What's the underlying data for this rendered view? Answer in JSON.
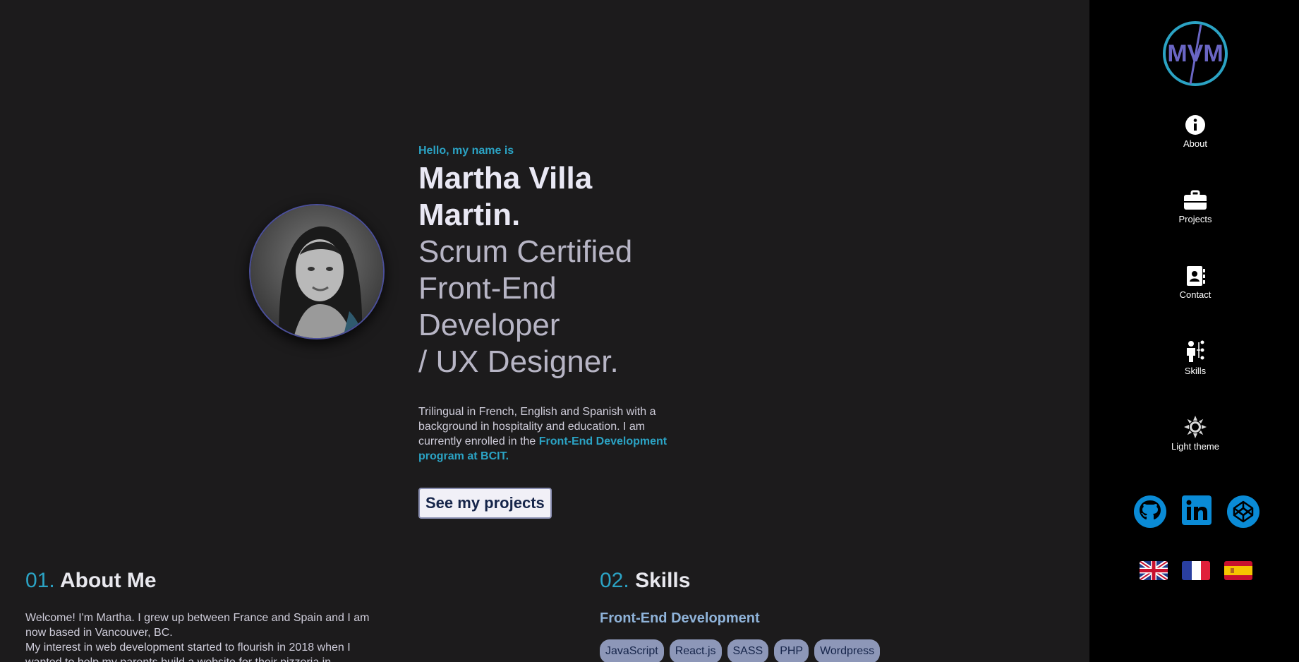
{
  "hero": {
    "greeting": "Hello, my name is",
    "name": "Martha Villa Martin.",
    "role_line1": "Scrum Certified",
    "role_line2": "Front-End Developer",
    "role_line3": "/ UX Designer.",
    "intro": "Trilingual in French, English and Spanish with a background in hospitality and education. I am currently enrolled in the ",
    "intro_highlight": "Front-End Development program at BCIT.",
    "cta_label": "See my projects"
  },
  "about": {
    "number": "01.",
    "title": "About Me",
    "paragraph1": "Welcome! I'm Martha. I grew up between France and Spain and I am now based in Vancouver, BC.",
    "paragraph2": "My interest in web development started to flourish in 2018 when I wanted to help my parents build a website for their pizzeria in"
  },
  "skills": {
    "number": "02.",
    "title": "Skills",
    "subtitle": "Front-End Development",
    "tags": [
      "JavaScript",
      "React.js",
      "SASS",
      "PHP",
      "Wordpress"
    ]
  },
  "sidebar": {
    "logo_text": "MVM",
    "nav": [
      {
        "label": "About",
        "icon": "info-icon"
      },
      {
        "label": "Projects",
        "icon": "briefcase-icon"
      },
      {
        "label": "Contact",
        "icon": "contact-book-icon"
      },
      {
        "label": "Skills",
        "icon": "skills-icon"
      },
      {
        "label": "Light theme",
        "icon": "sun-icon"
      }
    ],
    "social": [
      "github-icon",
      "linkedin-icon",
      "codepen-icon"
    ],
    "languages": [
      "uk-flag-icon",
      "france-flag-icon",
      "spain-flag-icon"
    ]
  },
  "colors": {
    "accent": "#2ba3c4",
    "background": "#1c1b1c",
    "sidebar": "#000000",
    "social_blue": "#0a8bd6"
  }
}
